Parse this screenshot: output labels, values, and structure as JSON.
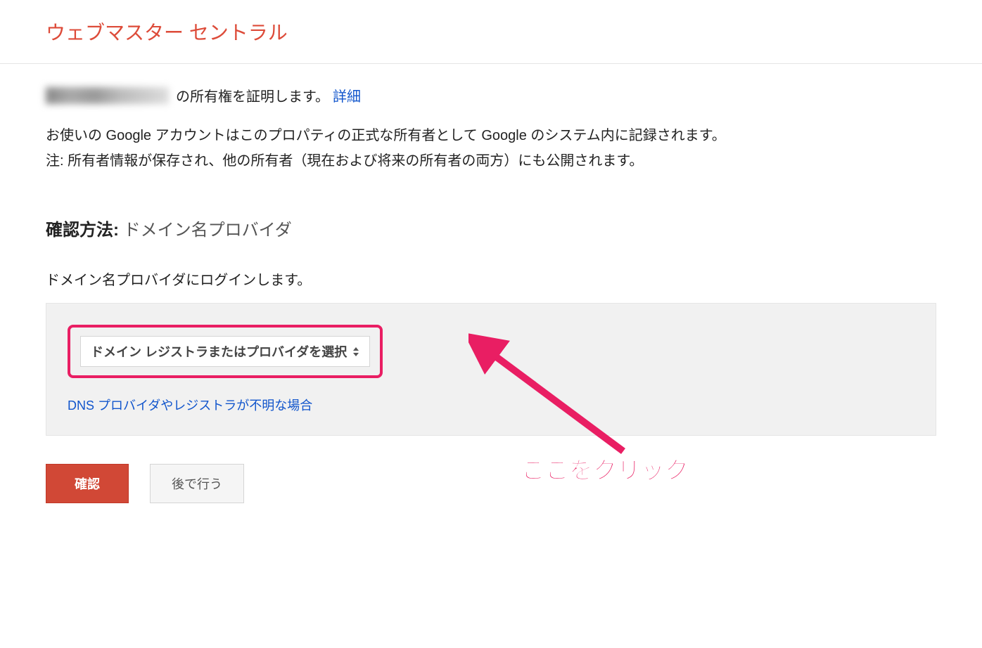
{
  "header": {
    "title": "ウェブマスター セントラル"
  },
  "ownership": {
    "text": "の所有権を証明します。",
    "detail_link": "詳細"
  },
  "info": {
    "line1": "お使いの Google アカウントはこのプロパティの正式な所有者として Google のシステム内に記録されます。",
    "line2": "注: 所有者情報が保存され、他の所有者（現在および将来の所有者の両方）にも公開されます。"
  },
  "verification": {
    "label": "確認方法:",
    "value": "ドメイン名プロバイダ"
  },
  "login_instruction": "ドメイン名プロバイダにログインします。",
  "provider": {
    "select_label": "ドメイン レジストラまたはプロバイダを選択",
    "unknown_link": "DNS プロバイダやレジストラが不明な場合"
  },
  "buttons": {
    "confirm": "確認",
    "later": "後で行う"
  },
  "annotation": {
    "text": "ここをクリック"
  }
}
